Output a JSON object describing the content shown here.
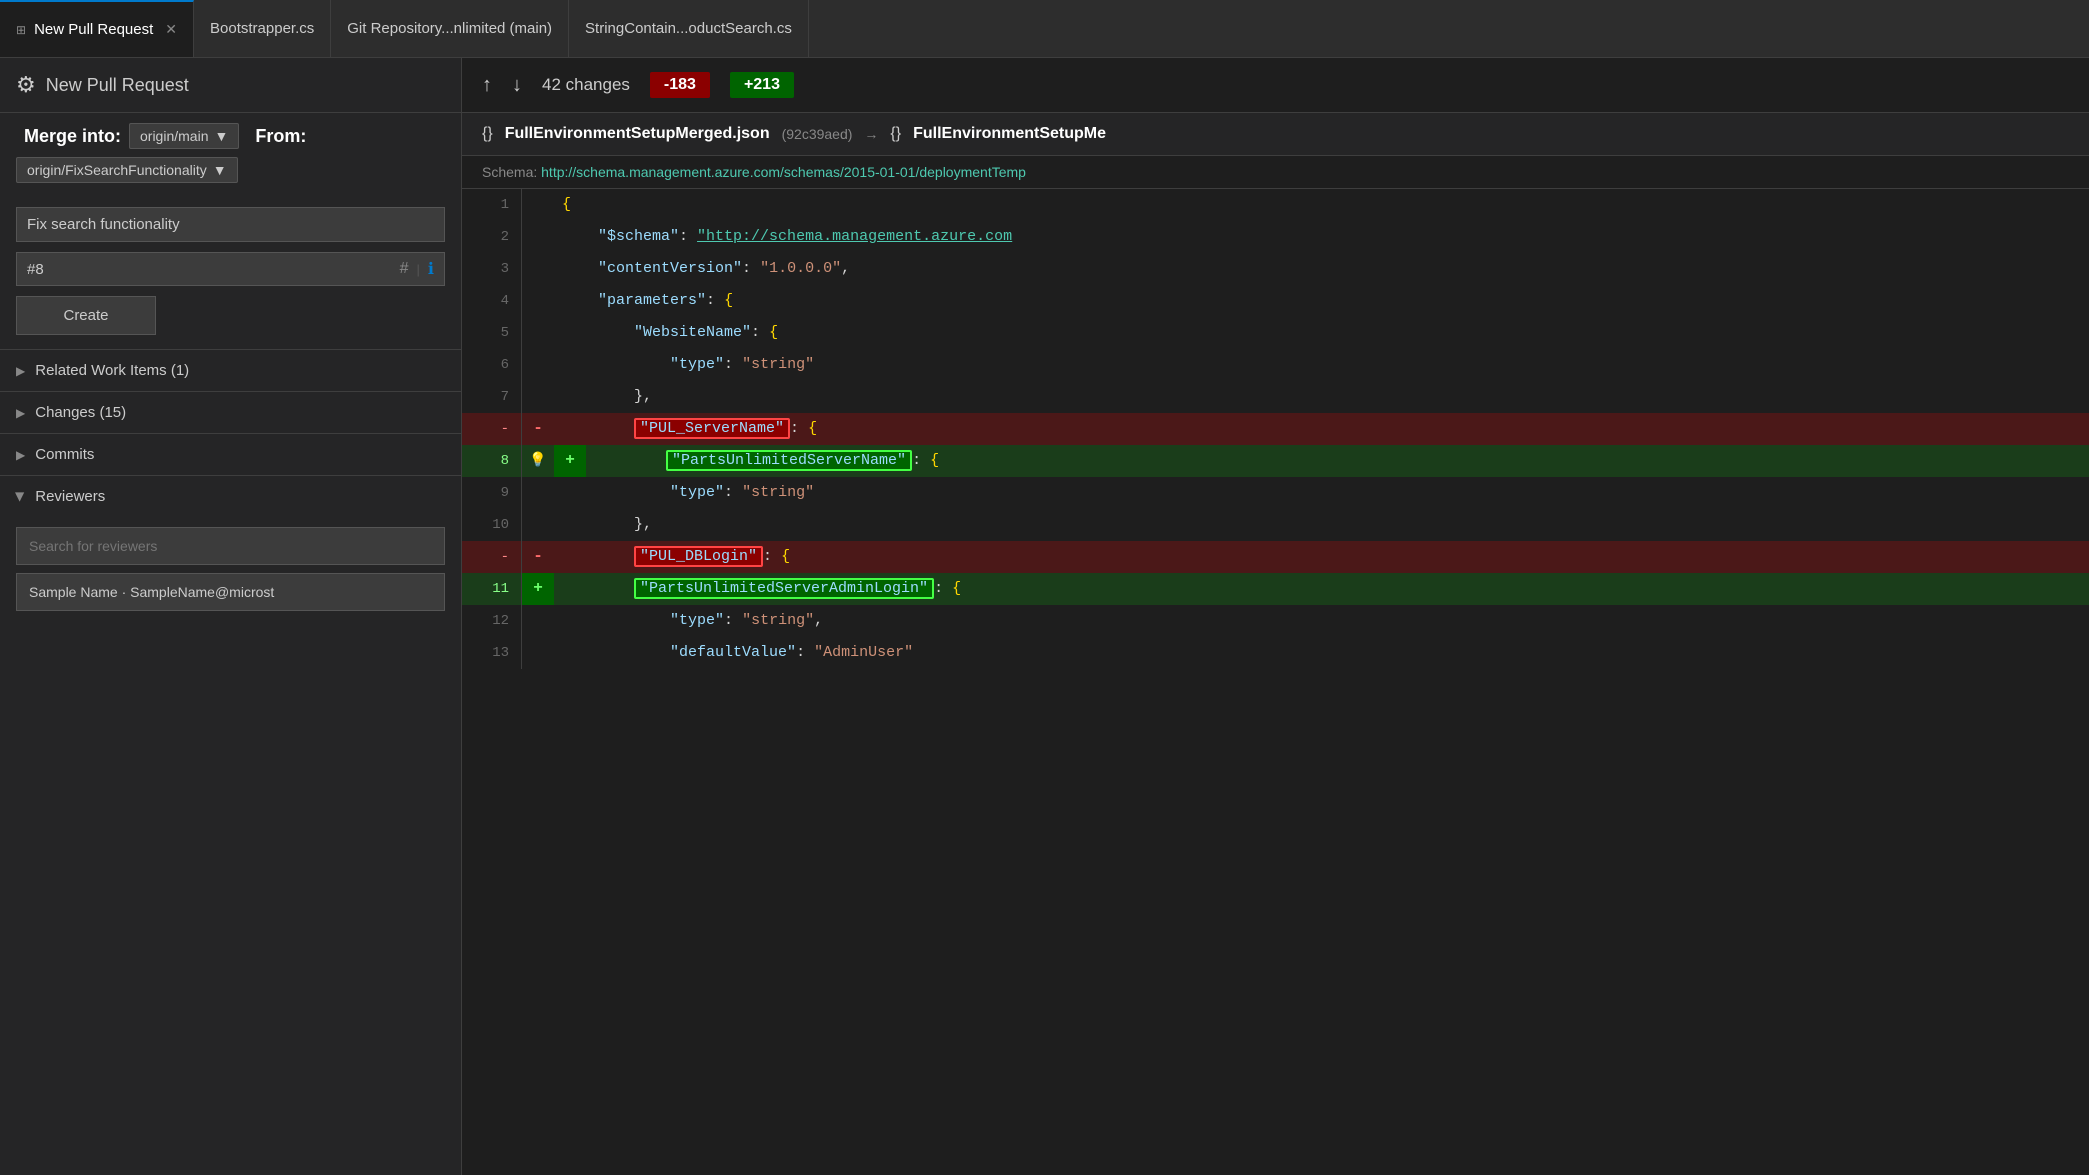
{
  "tabs": [
    {
      "id": "new-pr",
      "label": "New Pull Request",
      "active": true,
      "pinned": true,
      "closeable": true
    },
    {
      "id": "bootstrapper",
      "label": "Bootstrapper.cs",
      "active": false
    },
    {
      "id": "git-repo",
      "label": "Git Repository...nlimited (main)",
      "active": false
    },
    {
      "id": "string-contain",
      "label": "StringContain...oductSearch.cs",
      "active": false
    }
  ],
  "left_panel": {
    "pr_icon": "⚙",
    "pr_title": "New Pull Request",
    "merge_into_label": "Merge into:",
    "merge_branch": "origin/main",
    "from_label": "From:",
    "from_branch": "origin/FixSearchFunctionality",
    "title_input": "Fix search functionality",
    "pr_number": "#8",
    "description_placeholder": "",
    "create_button": "Create",
    "sections": [
      {
        "id": "related-work-items",
        "label": "Related Work Items (1)",
        "expanded": false,
        "chevron": "▶"
      },
      {
        "id": "changes",
        "label": "Changes (15)",
        "expanded": false,
        "chevron": "▶"
      },
      {
        "id": "commits",
        "label": "Commits",
        "expanded": false,
        "chevron": "▶"
      },
      {
        "id": "reviewers",
        "label": "Reviewers",
        "expanded": true,
        "chevron": "▼"
      }
    ],
    "reviewers": {
      "search_placeholder": "Search for reviewers",
      "items": [
        {
          "label": "Sample Name · SampleName@microst"
        }
      ]
    }
  },
  "right_panel": {
    "changes_count": "42 changes",
    "deletions": "-183",
    "additions": "+213",
    "file": {
      "name": "FullEnvironmentSetupMerged.json",
      "hash": "(92c39aed)",
      "arrow": "→",
      "name2": "FullEnvironmentSetupMe"
    },
    "schema_label": "Schema:",
    "schema_url": "http://schema.management.azure.com/schemas/2015-01-01/deploymentTemp",
    "lines": [
      {
        "num": "1",
        "type": "normal",
        "marker": "",
        "content": "{"
      },
      {
        "num": "2",
        "type": "normal",
        "marker": "",
        "content": "    \"$schema\": \"http://schema.management.azure.co"
      },
      {
        "num": "3",
        "type": "normal",
        "marker": "",
        "content": "    \"contentVersion\": \"1.0.0.0\","
      },
      {
        "num": "4",
        "type": "normal",
        "marker": "",
        "content": "    \"parameters\": {"
      },
      {
        "num": "5",
        "type": "normal",
        "marker": "",
        "content": "        \"WebsiteName\": {"
      },
      {
        "num": "6",
        "type": "normal",
        "marker": "",
        "content": "            \"type\": \"string\""
      },
      {
        "num": "7",
        "type": "normal",
        "marker": "",
        "content": "        },"
      },
      {
        "num": "-",
        "type": "deleted",
        "marker": "-",
        "content": "        \"PUL_ServerName\": {",
        "highlight": "PUL_ServerName"
      },
      {
        "num": "8",
        "type": "added",
        "marker": "+",
        "content": "        \"PartsUnlimitedServerName\": {",
        "highlight": "PartsUnlimitedServerName",
        "bulb": true
      },
      {
        "num": "9",
        "type": "normal",
        "marker": "",
        "content": "            \"type\": \"string\""
      },
      {
        "num": "10",
        "type": "normal",
        "marker": "",
        "content": "        },"
      },
      {
        "num": "-",
        "type": "deleted",
        "marker": "-",
        "content": "        \"PUL_DBLogin\": {",
        "highlight": "PUL_DBLogin"
      },
      {
        "num": "11",
        "type": "added",
        "marker": "+",
        "content": "        \"PartsUnlimitedServerAdminLogin\": {",
        "highlight": "PartsUnlimitedServerAdminLogin"
      },
      {
        "num": "12",
        "type": "normal",
        "marker": "",
        "content": "            \"type\": \"string\","
      },
      {
        "num": "13",
        "type": "normal",
        "marker": "",
        "content": "            \"defaultValue\": \"AdminUser\""
      }
    ]
  }
}
